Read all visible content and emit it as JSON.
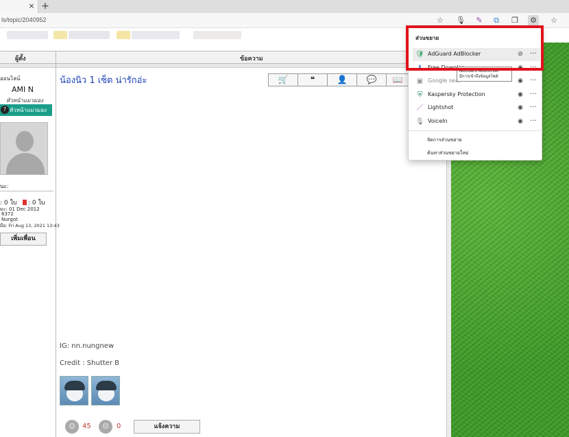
{
  "browser": {
    "tab_close": "×",
    "new_tab": "+",
    "url": "ls/topic/2040952"
  },
  "toolbar": {
    "favorite_icon": "☆",
    "mic_icon": "🎙",
    "pen_icon": "✎",
    "copy_icon": "⧉",
    "collections_icon": "❐",
    "extensions_icon": "⚙",
    "favorites_bar_icon": "☆"
  },
  "table": {
    "col_author": "ผู้ตั้ง",
    "col_message": "ข้อความ"
  },
  "profile": {
    "online": "ออนไลน์",
    "name": "AMI N",
    "title": "หัวหน้าแมวมอง",
    "badge": "หัวหน้าแมวมอง",
    "section_label": "นะ:",
    "stats": ": 0 ใบ",
    "red_stats": ": 0 ใบ",
    "joined": "มะ: 01 Dec 2012",
    "posts": "6372",
    "type": "Nurgot",
    "last": "มือ: Fri Aug 13, 2021 13:43",
    "add_friend": "เพิ่มเพื่อน"
  },
  "post": {
    "title": "น้องนิว 1 เซ็ต น่ารักอ่ะ",
    "actions": [
      "🛒",
      "❝",
      "👤",
      "💬",
      "📖"
    ],
    "ig": "IG: nn.nungnew",
    "credit": "Credit : Shutter B",
    "up_votes": "45",
    "down_votes": "0",
    "report": "แจ้งความ"
  },
  "extensions_popup": {
    "title": "ส่วนขยาย",
    "items": [
      {
        "name": "AdGuard AdBlocker",
        "icon": "🛡",
        "color": "#2e9e5b"
      },
      {
        "name": "Free Downloa",
        "icon": "⬇",
        "color": "#3a7bd5"
      },
      {
        "name": "Google sear",
        "icon": "▣",
        "color": "#999999"
      },
      {
        "name": "Kaspersky Protection",
        "icon": "⛨",
        "color": "#2b8a6e"
      },
      {
        "name": "Lightshot",
        "icon": "／",
        "color": "#9b59b6"
      },
      {
        "name": "VoiceIn",
        "icon": "🎙",
        "color": "#777777"
      }
    ],
    "tooltip_line1": "AdGuard AdBlocker",
    "tooltip_line2": "มีการเข้าถึงข้อมูลไซต์",
    "manage": "จัดการส่วนขยาย",
    "find_new": "ค้นหาส่วนขยายใหม่"
  },
  "colors": {
    "highlight_box": "#e0131b",
    "link_blue": "#1a3fb2"
  }
}
